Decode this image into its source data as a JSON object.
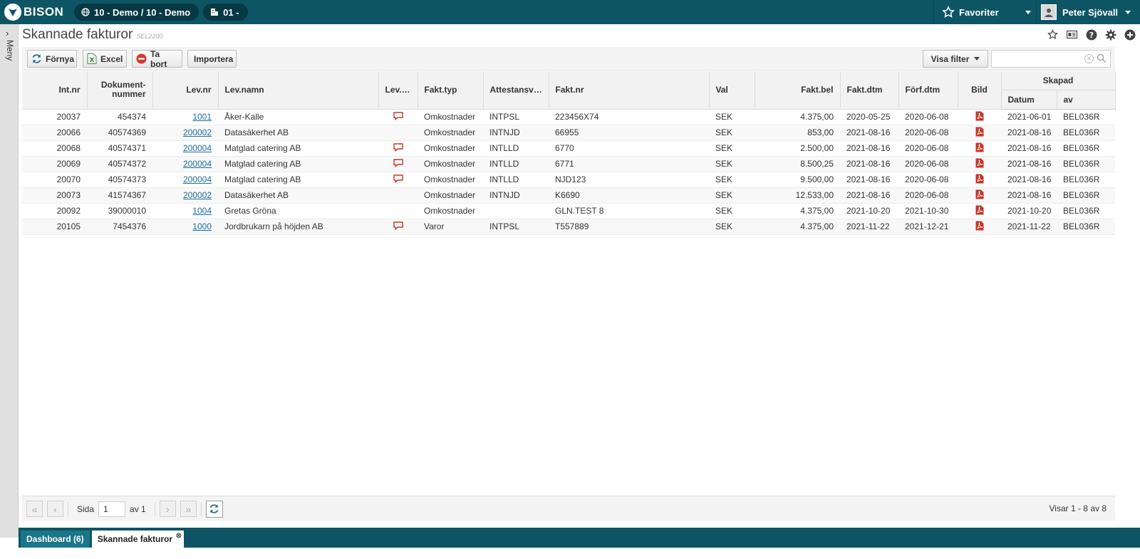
{
  "app": {
    "logo_text": "BISON"
  },
  "topbar": {
    "company": "10 - Demo / 10 - Demo",
    "unit": "01 -",
    "favorites_label": "Favoriter",
    "user_name": "Peter Sjövall"
  },
  "sidemenu": {
    "label": "Meny"
  },
  "page": {
    "title": "Skannade fakturor",
    "code": "SEL2200"
  },
  "toolbar": {
    "refresh_label": "Förnya",
    "excel_label": "Excel",
    "delete_label": "Ta bort",
    "import_label": "Importera",
    "filter_label": "Visa filter",
    "search_value": ""
  },
  "table": {
    "headers": {
      "intnr": "Int.nr",
      "docnr": "Dokument-nummer",
      "levnr": "Lev.nr",
      "levnamn": "Lev.namn",
      "levkom": "Lev.…",
      "fakttyp": "Fakt.typ",
      "attest": "Attestansv…",
      "faktnr": "Fakt.nr",
      "val": "Val",
      "faktbel": "Fakt.bel",
      "faktdtm": "Fakt.dtm",
      "forfdtm": "Förf.dtm",
      "bild": "Bild",
      "skapad": "Skapad",
      "datum": "Datum",
      "av": "av"
    },
    "rows": [
      {
        "intnr": "20037",
        "docnr": "454374",
        "levnr": "1001",
        "levnamn": "Åker-Kalle",
        "comment": true,
        "fakttyp": "Omkostnader",
        "attest": "INTPSL",
        "faktnr": "223456X74",
        "val": "SEK",
        "faktbel": "4.375,00",
        "faktdtm": "2020-05-25",
        "forfdtm": "2020-06-08",
        "datum": "2021-06-01",
        "av": "BEL036R"
      },
      {
        "intnr": "20066",
        "docnr": "40574369",
        "levnr": "200002",
        "levnamn": "Datasäkerhet AB",
        "comment": false,
        "fakttyp": "Omkostnader",
        "attest": "INTNJD",
        "faktnr": "66955",
        "val": "SEK",
        "faktbel": "853,00",
        "faktdtm": "2021-08-16",
        "forfdtm": "2020-06-08",
        "datum": "2021-08-16",
        "av": "BEL036R"
      },
      {
        "intnr": "20068",
        "docnr": "40574371",
        "levnr": "200004",
        "levnamn": "Matglad catering AB",
        "comment": true,
        "fakttyp": "Omkostnader",
        "attest": "INTLLD",
        "faktnr": "6770",
        "val": "SEK",
        "faktbel": "2.500,00",
        "faktdtm": "2021-08-16",
        "forfdtm": "2020-06-08",
        "datum": "2021-08-16",
        "av": "BEL036R"
      },
      {
        "intnr": "20069",
        "docnr": "40574372",
        "levnr": "200004",
        "levnamn": "Matglad catering AB",
        "comment": true,
        "fakttyp": "Omkostnader",
        "attest": "INTLLD",
        "faktnr": "6771",
        "val": "SEK",
        "faktbel": "8.500,25",
        "faktdtm": "2021-08-16",
        "forfdtm": "2020-06-08",
        "datum": "2021-08-16",
        "av": "BEL036R"
      },
      {
        "intnr": "20070",
        "docnr": "40574373",
        "levnr": "200004",
        "levnamn": "Matglad catering AB",
        "comment": true,
        "fakttyp": "Omkostnader",
        "attest": "INTLLD",
        "faktnr": "NJD123",
        "val": "SEK",
        "faktbel": "9.500,00",
        "faktdtm": "2021-08-16",
        "forfdtm": "2020-06-08",
        "datum": "2021-08-16",
        "av": "BEL036R"
      },
      {
        "intnr": "20073",
        "docnr": "41574367",
        "levnr": "200002",
        "levnamn": "Datasäkerhet AB",
        "comment": false,
        "fakttyp": "Omkostnader",
        "attest": "INTNJD",
        "faktnr": "K6690",
        "val": "SEK",
        "faktbel": "12.533,00",
        "faktdtm": "2021-08-16",
        "forfdtm": "2020-06-08",
        "datum": "2021-08-16",
        "av": "BEL036R"
      },
      {
        "intnr": "20092",
        "docnr": "39000010",
        "levnr": "1004",
        "levnamn": "Gretas Gröna",
        "comment": false,
        "fakttyp": "Omkostnader",
        "attest": "",
        "faktnr": "GLN.TEST 8",
        "val": "SEK",
        "faktbel": "4.375,00",
        "faktdtm": "2021-10-20",
        "forfdtm": "2021-10-30",
        "datum": "2021-10-20",
        "av": "BEL036R"
      },
      {
        "intnr": "20105",
        "docnr": "7454376",
        "levnr": "1000",
        "levnamn": "Jordbrukarn på höjden AB",
        "comment": true,
        "fakttyp": "Varor",
        "attest": "INTPSL",
        "faktnr": "T557889",
        "val": "SEK",
        "faktbel": "4.375,00",
        "faktdtm": "2021-11-22",
        "forfdtm": "2021-12-21",
        "datum": "2021-11-22",
        "av": "BEL036R"
      }
    ]
  },
  "pager": {
    "page_label": "Sida",
    "page_value": "1",
    "of_label": "av 1",
    "info": "Visar 1 - 8 av 8"
  },
  "bottom_tabs": {
    "dashboard": "Dashboard (6)",
    "current": "Skannade fakturor"
  },
  "colors": {
    "topbar": "#0d5564",
    "link": "#1a6fa3",
    "comment_icon": "#c0392b",
    "pdf_icon": "#c0392b"
  }
}
